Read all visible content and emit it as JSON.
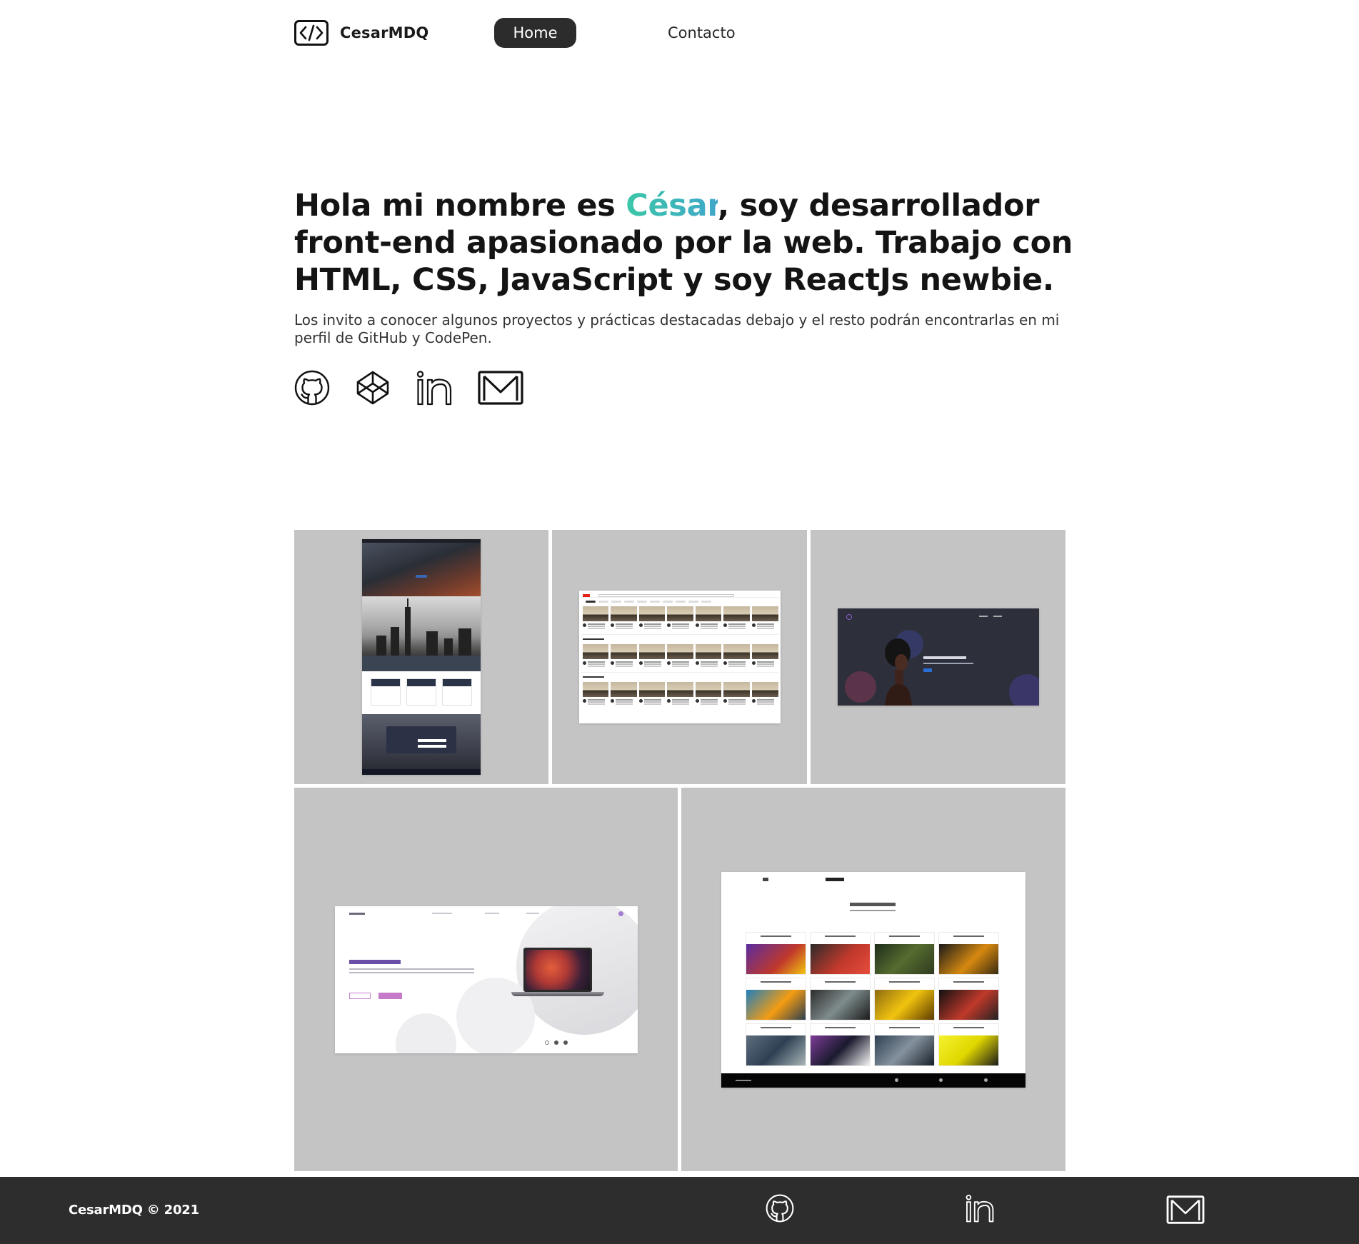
{
  "header": {
    "logo_text": "CesarMDQ",
    "nav": {
      "home_label": "Home",
      "contact_label": "Contacto"
    }
  },
  "hero": {
    "title_before": "Hola mi nombre es ",
    "title_name": "César",
    "title_after": ", soy desarrollador front-end apasionado por la web. Trabajo con HTML, CSS, JavaScript y soy ReactJs newbie.",
    "subtitle": "Los invito a conocer algunos proyectos y prácticas destacadas debajo y el resto podrán encontrarlas en mi perfil de GitHub y CodePen.",
    "accent_colors": [
      "#3cc7a8",
      "#3fa7c9"
    ]
  },
  "socials": [
    {
      "icon": "github-icon"
    },
    {
      "icon": "codepen-icon"
    },
    {
      "icon": "linkedin-icon"
    },
    {
      "icon": "mail-icon"
    }
  ],
  "projects": {
    "tile_background": "#c4c4c4",
    "items": [
      {
        "preview": "travel-landing-page"
      },
      {
        "preview": "video-platform-clone"
      },
      {
        "preview": "music-landing",
        "headline": "Siente la música"
      },
      {
        "preview": "laptop-product-page",
        "headline": "Laptop para el futuro"
      },
      {
        "preview": "game-store",
        "headline": "Biblioteca de juegos"
      }
    ]
  },
  "footer": {
    "copyright": "CesarMDQ © 2021",
    "background": "#2d2d2d",
    "links": [
      {
        "icon": "github-icon"
      },
      {
        "icon": "linkedin-icon"
      },
      {
        "icon": "mail-icon"
      }
    ]
  }
}
